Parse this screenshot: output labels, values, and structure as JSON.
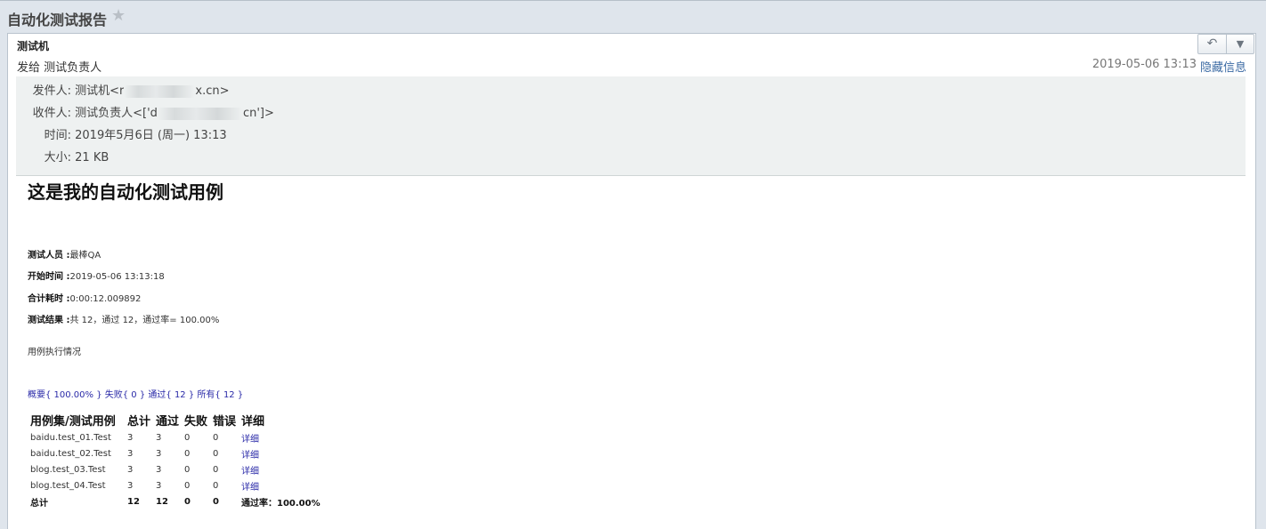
{
  "window": {
    "title": "自动化测试报告",
    "star_icon": "star-icon"
  },
  "mail": {
    "sender_name": "测试机",
    "to_line": "发给 测试负责人",
    "date_short": "2019-05-06 13:13",
    "hide_info": "隐藏信息",
    "details": {
      "from_label": "发件人:",
      "from_prefix": "测试机<r",
      "from_suffix": "x.cn>",
      "to_label": "收件人:",
      "to_prefix": "测试负责人<['d",
      "to_suffix": "cn']>",
      "time_label": "时间:",
      "time_value": "2019年5月6日 (周一) 13:13",
      "size_label": "大小:",
      "size_value": "21 KB"
    }
  },
  "report": {
    "title": "这是我的自动化测试用例",
    "tester_label": "测试人员 :",
    "tester_value": "最棒QA",
    "start_label": "开始时间 :",
    "start_value": "2019-05-06 13:13:18",
    "elapsed_label": "合计耗时 :",
    "elapsed_value": "0:00:12.009892",
    "result_label": "测试结果 :",
    "result_value": "共 12，通过 12，通过率= 100.00%",
    "exec_title": "用例执行情况",
    "filters": [
      "概要{ 100.00% }",
      "失败{ 0 }",
      "通过{ 12 }",
      "所有{ 12 }"
    ],
    "table": {
      "headers": [
        "用例集/测试用例",
        "总计",
        "通过",
        "失败",
        "错误",
        "详细"
      ],
      "rows": [
        [
          "baidu.test_01.Test",
          "3",
          "3",
          "0",
          "0",
          "详细"
        ],
        [
          "baidu.test_02.Test",
          "3",
          "3",
          "0",
          "0",
          "详细"
        ],
        [
          "blog.test_03.Test",
          "3",
          "3",
          "0",
          "0",
          "详细"
        ],
        [
          "blog.test_04.Test",
          "3",
          "3",
          "0",
          "0",
          "详细"
        ]
      ],
      "total": [
        "总计",
        "12",
        "12",
        "0",
        "0",
        "通过率：100.00%"
      ]
    }
  }
}
